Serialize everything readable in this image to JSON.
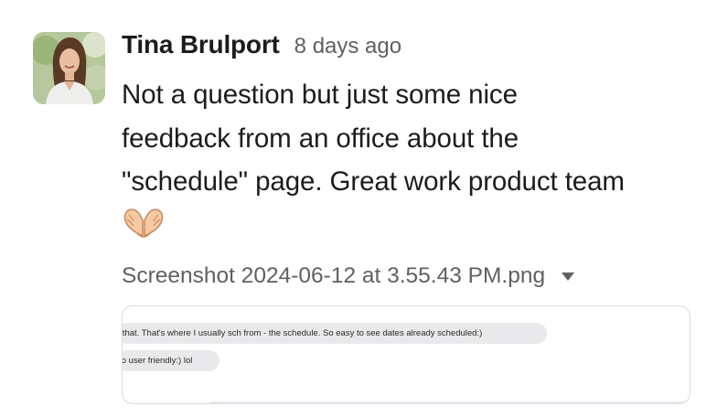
{
  "message": {
    "author": "Tina Brulport",
    "timestamp": "8 days ago",
    "body_lines": [
      "Not a question but just some nice",
      "feedback from an office about the",
      "\"schedule\" page. Great work product team"
    ],
    "emoji": "heart-hands-emoji"
  },
  "attachment": {
    "filename": "Screenshot 2024-06-12 at 3.55.43 PM.png",
    "toggle_icon": "caret-down-icon",
    "preview": {
      "bubbles": [
        "r that. That's where I usually sch from - the schedule. So easy to see dates already scheduled:)",
        "so user friendly:) lol"
      ]
    }
  },
  "colors": {
    "text_primary": "#1d1c1d",
    "text_secondary": "#616061",
    "bubble_bg": "#e9e9eb",
    "preview_border": "#dcdcdc"
  }
}
